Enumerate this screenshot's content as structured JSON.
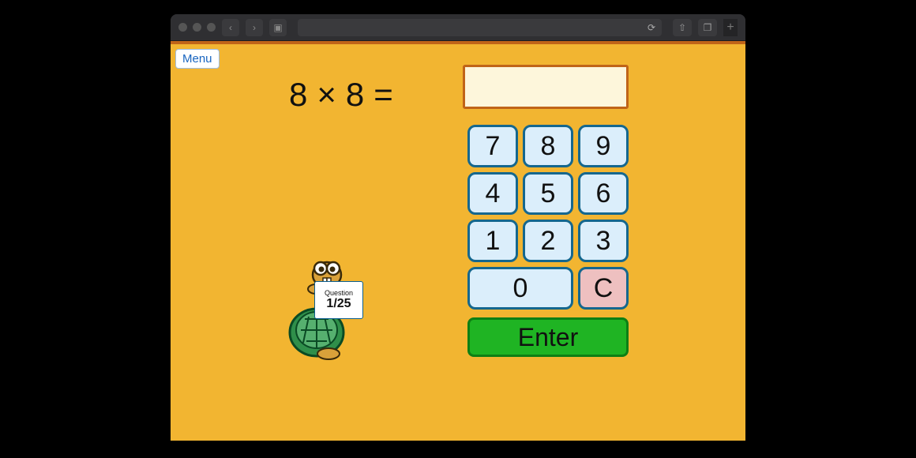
{
  "browser": {
    "back": "‹",
    "forward": "›",
    "sidebar": "▣",
    "reload": "⟳",
    "share": "⇧",
    "tabs": "❐",
    "newtab": "+"
  },
  "menu_label": "Menu",
  "equation": {
    "a": "8",
    "op": "×",
    "b": "8",
    "eq": "="
  },
  "answer_value": "",
  "keypad": {
    "k7": "7",
    "k8": "8",
    "k9": "9",
    "k4": "4",
    "k5": "5",
    "k6": "6",
    "k1": "1",
    "k2": "2",
    "k3": "3",
    "k0": "0",
    "clear": "C"
  },
  "enter_label": "Enter",
  "progress": {
    "label": "Question",
    "value": "1/25"
  }
}
